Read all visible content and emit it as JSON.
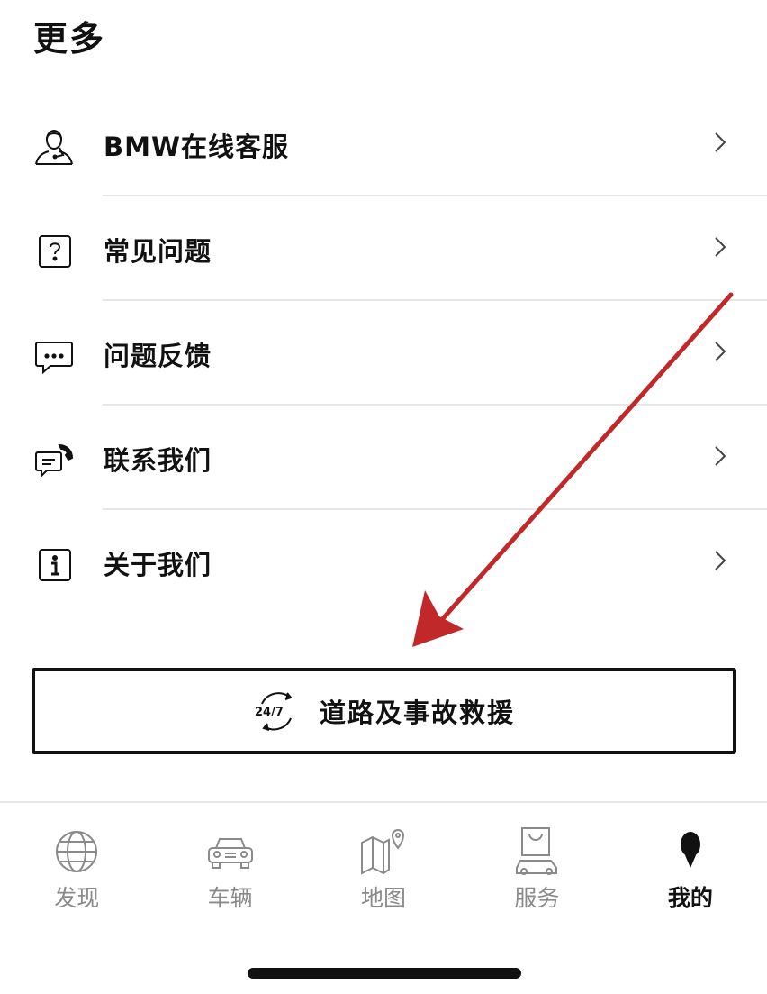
{
  "header": {
    "title": "更多"
  },
  "menu": {
    "items": [
      {
        "label": "BMW在线客服",
        "icon": "customer-service-icon"
      },
      {
        "label": "常见问题",
        "icon": "question-icon"
      },
      {
        "label": "问题反馈",
        "icon": "feedback-chat-icon"
      },
      {
        "label": "联系我们",
        "icon": "contact-phone-icon"
      },
      {
        "label": "关于我们",
        "icon": "info-icon"
      }
    ]
  },
  "assistance": {
    "badge": "24/7",
    "label": "道路及事故救援",
    "icon": "roadside-assistance-icon"
  },
  "tabbar": {
    "tabs": [
      {
        "label": "发现",
        "icon": "globe-icon",
        "active": false
      },
      {
        "label": "车辆",
        "icon": "car-front-icon",
        "active": false
      },
      {
        "label": "地图",
        "icon": "map-pin-icon",
        "active": false
      },
      {
        "label": "服务",
        "icon": "service-bag-car-icon",
        "active": false
      },
      {
        "label": "我的",
        "icon": "profile-icon",
        "active": true
      }
    ]
  },
  "colors": {
    "text": "#111111",
    "inactive": "#8a8a8a",
    "divider": "#e6e6e6",
    "annotation_arrow": "#c0282a"
  }
}
